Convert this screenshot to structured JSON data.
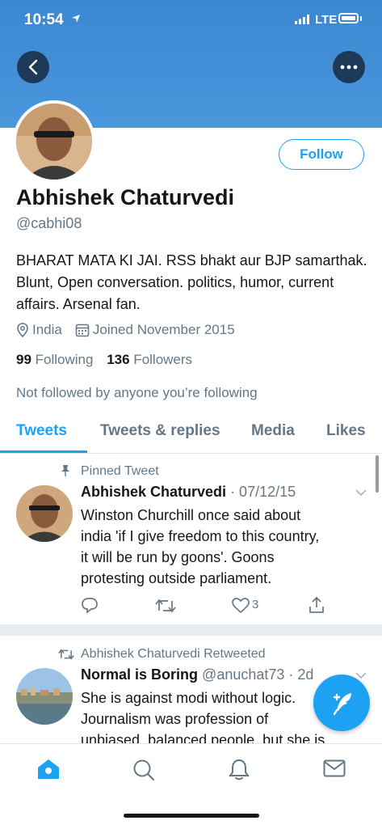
{
  "status_bar": {
    "time": "10:54",
    "network": "LTE"
  },
  "profile": {
    "follow_label": "Follow",
    "name": "Abhishek Chaturvedi",
    "handle": "@cabhi08",
    "bio": "BHARAT MATA KI JAI. RSS bhakt aur BJP samarthak. Blunt, Open conversation. politics, humor, current affairs. Arsenal fan.",
    "location": "India",
    "joined": "Joined November 2015",
    "following_count": "99",
    "following_label": "Following",
    "followers_count": "136",
    "followers_label": "Followers",
    "not_followed_text": "Not followed by anyone you’re following"
  },
  "tabs": [
    {
      "label": "Tweets",
      "active": true
    },
    {
      "label": "Tweets & replies",
      "active": false
    },
    {
      "label": "Media",
      "active": false
    },
    {
      "label": "Likes",
      "active": false
    }
  ],
  "tweets": [
    {
      "context": "Pinned Tweet",
      "author": "Abhishek Chaturvedi",
      "date": "· 07/12/15",
      "lines": [
        "Winston Churchill once said about",
        "india 'if I give freedom to this country,",
        "it will be run by goons'. Goons",
        "protesting outside parliament."
      ],
      "likes": "3"
    },
    {
      "context": "Abhishek Chaturvedi Retweeted",
      "author": "Normal is Boring",
      "handle": "@anuchat73",
      "date": "· 2d",
      "lines": [
        "She is against modi without logic.",
        "Journalism was profession of",
        "unbiased, balanced people, but she is"
      ]
    }
  ],
  "colors": {
    "accent": "#1da1f2",
    "header": "#4a97de",
    "secondary_text": "#657786"
  }
}
